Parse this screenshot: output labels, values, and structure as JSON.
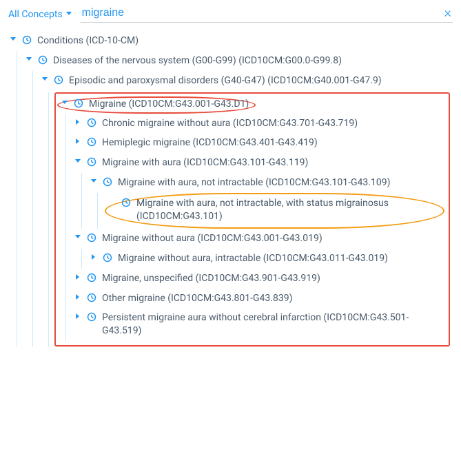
{
  "topbar": {
    "dropdown_label": "All Concepts",
    "search_value": "migraine"
  },
  "tree": {
    "root": {
      "label": "Conditions (ICD-10-CM)",
      "child": {
        "label": "Diseases of the nervous system (G00-G99) (ICD10CM:G00.0-G99.8)",
        "child": {
          "label": "Episodic and paroxysmal disorders (G40-G47) (ICD10CM:G40.001-G47.9)",
          "migraine": {
            "label": "Migraine (ICD10CM:G43.001-G43.D1)",
            "items": {
              "chronic": "Chronic migraine without aura (ICD10CM:G43.701-G43.719)",
              "hemiplegic": "Hemiplegic migraine (ICD10CM:G43.401-G43.419)",
              "with_aura": {
                "label": "Migraine with aura (ICD10CM:G43.101-G43.119)",
                "not_intractable": {
                  "label": "Migraine with aura, not intractable (ICD10CM:G43.101-G43.109)",
                  "leaf": "Migraine with aura, not intractable, with status migrainosus (ICD10CM:G43.101)"
                }
              },
              "without_aura": {
                "label": "Migraine without aura (ICD10CM:G43.001-G43.019)",
                "intractable": "Migraine without aura, intractable (ICD10CM:G43.011-G43.019)"
              },
              "unspecified": "Migraine, unspecified (ICD10CM:G43.901-G43.919)",
              "other": "Other migraine (ICD10CM:G43.801-G43.839)",
              "persistent_aura": "Persistent migraine aura without cerebral infarction (ICD10CM:G43.501-G43.519)"
            }
          }
        }
      }
    }
  },
  "annotations": {
    "red_box": "migraine-subtree",
    "red_ellipse": "migraine-row",
    "orange_ellipse": "status-migrainosus-row"
  }
}
